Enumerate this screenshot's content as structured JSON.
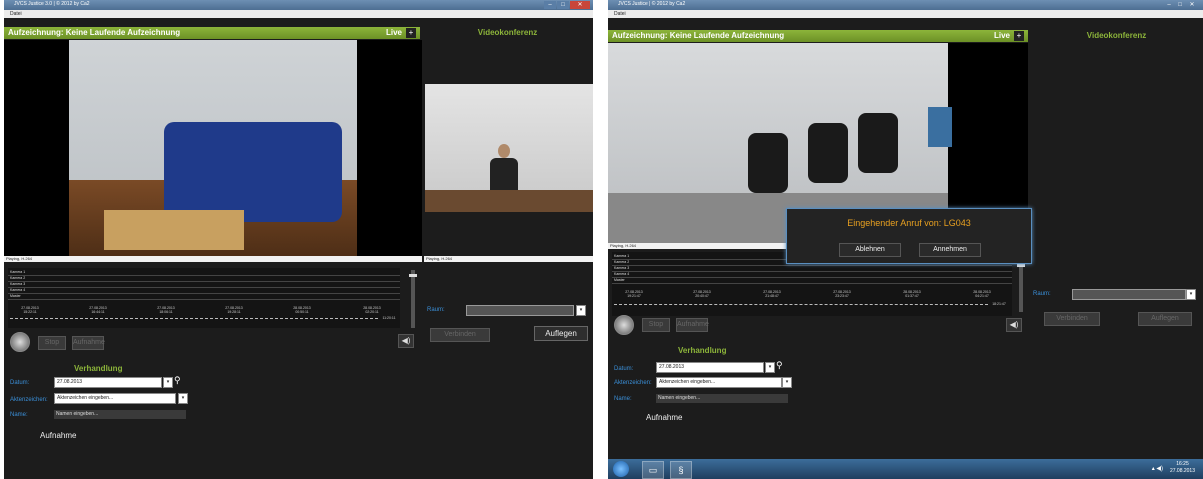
{
  "left": {
    "title": "JVCS Justice 3.0 | © 2012 by Ca2",
    "menu": "Datei",
    "recording_label": "Aufzeichnung:  Keine Laufende Aufzeichnung",
    "live_label": "Live",
    "live_button": "+",
    "videoconf_label": "Videokonferenz",
    "playbar_main": "Playing, H.264",
    "playbar_side": "Playing, H.264",
    "tracks": [
      "Kamera 1",
      "Kamera 2",
      "Kamera 3",
      "Kamera 4",
      "Master"
    ],
    "timestamps": [
      {
        "date": "27.08.2013",
        "time": "15:22:11"
      },
      {
        "date": "27.08.2013",
        "time": "16:44:11"
      },
      {
        "date": "27.08.2013",
        "time": "18:06:11"
      },
      {
        "date": "27.08.2013",
        "time": "19:28:11"
      },
      {
        "date": "28.08.2013",
        "time": "00:50:11"
      },
      {
        "date": "28.08.2013",
        "time": "02:20:11"
      }
    ],
    "ruler_end": "11:20:11",
    "btn_stop": "Stop",
    "btn_record": "Aufnahme",
    "raum_label": "Raum:",
    "btn_connect": "Verbinden",
    "btn_hangup": "Auflegen",
    "section": "Verhandlung",
    "datum_label": "Datum:",
    "datum_value": "27.08.2013",
    "az_label": "Aktenzeichen:",
    "az_placeholder": "Aktenzeichen eingeben...",
    "name_label": "Name:",
    "name_placeholder": "Namen eingeben...",
    "aufnahme_label": "Aufnahme"
  },
  "right": {
    "title": "JVCS Justice | © 2012 by Ca2",
    "menu": "Datei",
    "recording_label": "Aufzeichnung:  Keine Laufende Aufzeichnung",
    "live_label": "Live",
    "live_button": "+",
    "videoconf_label": "Videokonferenz",
    "playbar_main": "Playing, H.264",
    "tracks": [
      "Kamera 1",
      "Kamera 2",
      "Kamera 3",
      "Kamera 4",
      "Master"
    ],
    "timestamps": [
      {
        "date": "27.08.2013",
        "time": "19:21:47"
      },
      {
        "date": "27.08.2013",
        "time": "20:40:47"
      },
      {
        "date": "27.08.2013",
        "time": "21:48:47"
      },
      {
        "date": "27.08.2013",
        "time": "23:23:47"
      },
      {
        "date": "28.08.2013",
        "time": "01:37:47"
      },
      {
        "date": "28.08.2013",
        "time": "04:21:47"
      }
    ],
    "ruler_end": "18:21:47",
    "btn_stop": "Stop",
    "btn_record": "Aufnahme",
    "raum_label": "Raum:",
    "btn_connect": "Verbinden",
    "btn_hangup": "Auflegen",
    "section": "Verhandlung",
    "datum_label": "Datum:",
    "datum_value": "27.08.2013",
    "az_label": "Aktenzeichen:",
    "az_placeholder": "Aktenzeichen eingeben...",
    "name_label": "Name:",
    "name_placeholder": "Namen eingeben...",
    "aufnahme_label": "Aufnahme",
    "dialog": {
      "title": "Eingehender Anruf von: LG043",
      "decline": "Ablehnen",
      "accept": "Annehmen"
    },
    "taskbar": {
      "time": "16:25",
      "date": "27.08.2013",
      "icons": [
        "windows-start-orb",
        "folder-icon",
        "app-icon"
      ]
    }
  },
  "colors": {
    "accent_green": "#8cb43a",
    "label_blue": "#3a8fd8",
    "dialog_orange": "#e8a020",
    "dialog_border": "#5a8fc0"
  }
}
